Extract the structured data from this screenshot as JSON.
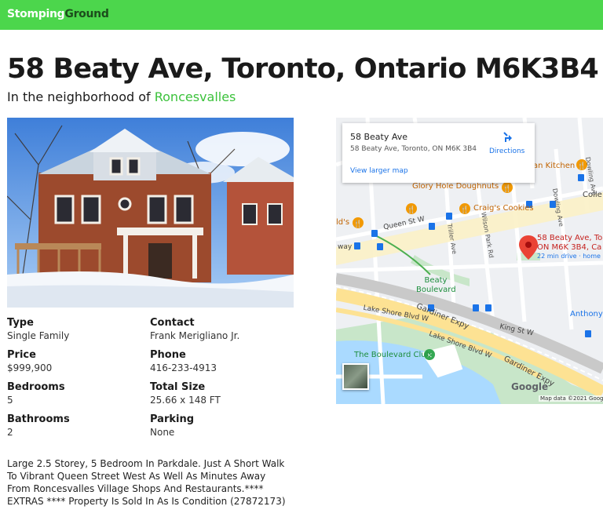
{
  "header": {
    "brand_primary": "Stomping",
    "brand_secondary": "Ground"
  },
  "listing": {
    "title": "58 Beaty Ave, Toronto, Ontario M6K3B4",
    "neighborhood_prefix": "In the neighborhood of ",
    "neighborhood": "Roncesvalles",
    "facts": [
      {
        "label": "Type",
        "value": "Single Family"
      },
      {
        "label": "Contact",
        "value": "Frank Merigliano Jr."
      },
      {
        "label": "Price",
        "value": "$999,900"
      },
      {
        "label": "Phone",
        "value": "416-233-4913"
      },
      {
        "label": "Bedrooms",
        "value": "5"
      },
      {
        "label": "Total Size",
        "value": "25.66 x 148 FT"
      },
      {
        "label": "Bathrooms",
        "value": "2"
      },
      {
        "label": "Parking",
        "value": "None"
      }
    ],
    "description": "Large 2.5 Storey, 5 Bedroom In Parkdale. Just A Short Walk To Vibrant Queen Street West As Well As Minutes Away From Roncesvalles Village Shops And Restaurants.**** EXTRAS **** Property Is Sold In As Is Condition (27872173)"
  },
  "map": {
    "card_title": "58 Beaty Ave",
    "card_address": "58 Beaty Ave, Toronto, ON M6K 3B4",
    "directions_label": "Directions",
    "larger_map_link": "View larger map",
    "labels": {
      "glory_hole": "Glory Hole Doughnuts",
      "craigs": "Craig's Cookies",
      "kitchen": "an Kitchen",
      "colle": "Colle",
      "olds": "ld's",
      "queen": "Queen St W",
      "way": "way",
      "triller": "Triller Ave",
      "wilson": "Wilson Park Rd",
      "dowling1": "Dowling Ave",
      "dowling2": "Dowling Ave",
      "marker_line1": "58 Beaty Ave, To",
      "marker_line2": "ON M6K 3B4, Ca",
      "drive_time": "22 min drive · home",
      "beaty_blvd": "Beaty Boulevard",
      "king": "King St W",
      "anthony": "Anthony",
      "gardiner1": "Gardiner Expy",
      "gardiner2": "Gardiner Expy",
      "lakeshore1": "Lake Shore Blvd W",
      "lakeshore2": "Lake Shore Blvd W",
      "boulevard_club": "The Boulevard Club",
      "google": "Google",
      "mapdata": "Map data ©2021 Goog"
    },
    "colors": {
      "road": "#ffffff",
      "highway": "#fde293",
      "water": "#aadaff",
      "park": "#c8e6c9",
      "poi_food": "#f29900",
      "transit": "#1a73e8",
      "marker": "#ea4335"
    }
  },
  "icons": {
    "directions": "directions-arrow-icon",
    "food": "fork-knife-icon",
    "transit": "bus-stop-icon",
    "marker": "map-pin-icon"
  }
}
